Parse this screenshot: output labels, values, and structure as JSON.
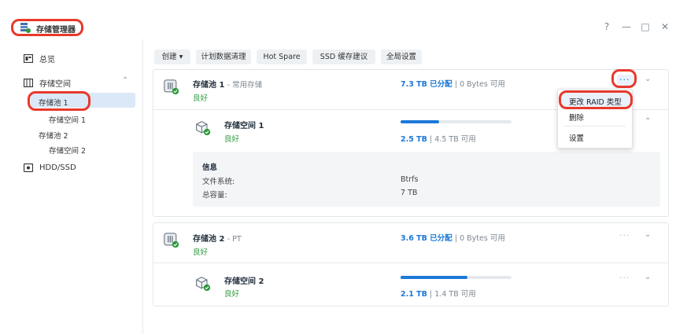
{
  "app": {
    "title": "存储管理器"
  },
  "window": {
    "help": "?",
    "minimize": "—",
    "maximize": "□",
    "close": "✕"
  },
  "sidebar": {
    "overview": "总览",
    "storage": "存储空间",
    "pools": [
      {
        "label": "存储池 1",
        "volume": "存储空间 1"
      },
      {
        "label": "存储池 2",
        "volume": "存储空间 2"
      }
    ],
    "hdd": "HDD/SSD"
  },
  "toolbar": {
    "create": "创建 ▾",
    "schedule": "计划数据清理",
    "hotspare": "Hot Spare",
    "ssd": "SSD 缓存建议",
    "global": "全局设置"
  },
  "pool1": {
    "name": "存储池 1",
    "desc": "- 常用存储",
    "status": "良好",
    "allocated": "7.3 TB 已分配",
    "available": "| 0 Bytes 可用",
    "volume": {
      "name": "存储空间 1",
      "status": "良好",
      "used": "2.5 TB",
      "available": "| 4.5 TB 可用",
      "usage_fraction": 0.35
    },
    "info": {
      "title": "信息",
      "fs_label": "文件系统:",
      "fs_value": "Btrfs",
      "cap_label": "总容量:",
      "cap_value": "7 TB"
    }
  },
  "pool2": {
    "name": "存储池 2",
    "desc": "- PT",
    "status": "良好",
    "allocated": "3.6 TB 已分配",
    "available": "| 0 Bytes 可用",
    "volume": {
      "name": "存储空间 2",
      "status": "良好",
      "used": "2.1 TB",
      "available": "| 1.4 TB 可用",
      "usage_fraction": 0.6
    }
  },
  "menu": {
    "more": "···",
    "items": [
      "更改 RAID 类型",
      "删除",
      "设置"
    ]
  },
  "icons": {
    "chevron_down": "⌄",
    "chevron_up": "⌃"
  },
  "colors": {
    "accent": "#1c78d8",
    "good": "#2c9a3a",
    "highlight": "#e8392b",
    "selected": "#dbe8f7"
  }
}
